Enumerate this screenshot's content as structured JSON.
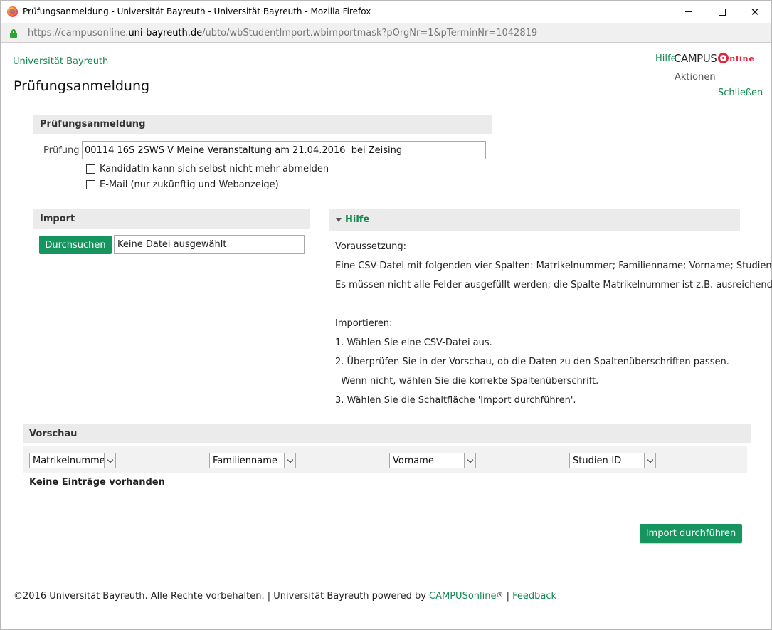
{
  "window": {
    "title": "Prüfungsanmeldung - Universität Bayreuth - Universität Bayreuth - Mozilla Firefox"
  },
  "urlbar": {
    "prefix": "https://campusonline.",
    "host": "uni-bayreuth.de",
    "path": "/ubto/wbStudentImport.wbimportmask?pOrgNr=1&pTerminNr=1042819"
  },
  "header": {
    "university": "Universität Bayreuth",
    "page_title": "Prüfungsanmeldung",
    "help": "Hilfe",
    "logo_campus": "CAMPUS",
    "logo_online": "nline",
    "actions": "Aktionen",
    "close": "Schließen"
  },
  "exam_section": {
    "title": "Prüfungsanmeldung",
    "exam_label": "Prüfung",
    "exam_value": "00114 16S 2SWS V Meine Veranstaltung am 21.04.2016  bei Zeising",
    "checkbox1": "KandidatIn kann sich selbst nicht mehr abmelden",
    "checkbox2": "E-Mail (nur zukünftig und Webanzeige)"
  },
  "import_section": {
    "title": "Import",
    "browse_button": "Durchsuchen",
    "file_status": "Keine Datei ausgewählt"
  },
  "help_section": {
    "title": "Hilfe",
    "lines": [
      "Voraussetzung:",
      "Eine CSV-Datei mit folgenden vier Spalten: Matrikelnummer; Familienname; Vorname; Studien-ID.",
      "Es müssen nicht alle Felder ausgefüllt werden; die Spalte Matrikelnummer ist z.B. ausreichend.",
      "Importieren:",
      "1. Wählen Sie eine CSV-Datei aus.",
      "2. Überprüfen Sie in der Vorschau, ob die Daten zu den Spaltenüberschriften passen.",
      "  Wenn nicht, wählen Sie die korrekte Spaltenüberschrift.",
      "3. Wählen Sie die Schaltfläche 'Import durchführen'."
    ]
  },
  "preview_section": {
    "title": "Vorschau",
    "columns": [
      "Matrikelnummer",
      "Familienname",
      "Vorname",
      "Studien-ID"
    ],
    "empty_message": "Keine Einträge vorhanden"
  },
  "import_button": "Import durchführen",
  "footer": {
    "copyright": "©2016 Universität Bayreuth. Alle Rechte vorbehalten. | Universität Bayreuth powered by ",
    "campus_link": "CAMPUSonline",
    "reg": "®",
    "separator": " | ",
    "feedback": "Feedback"
  },
  "colors": {
    "accent_green": "#16955f",
    "link_green": "#12874f",
    "section_bg": "#ebebeb",
    "logo_red": "#e8233c"
  }
}
